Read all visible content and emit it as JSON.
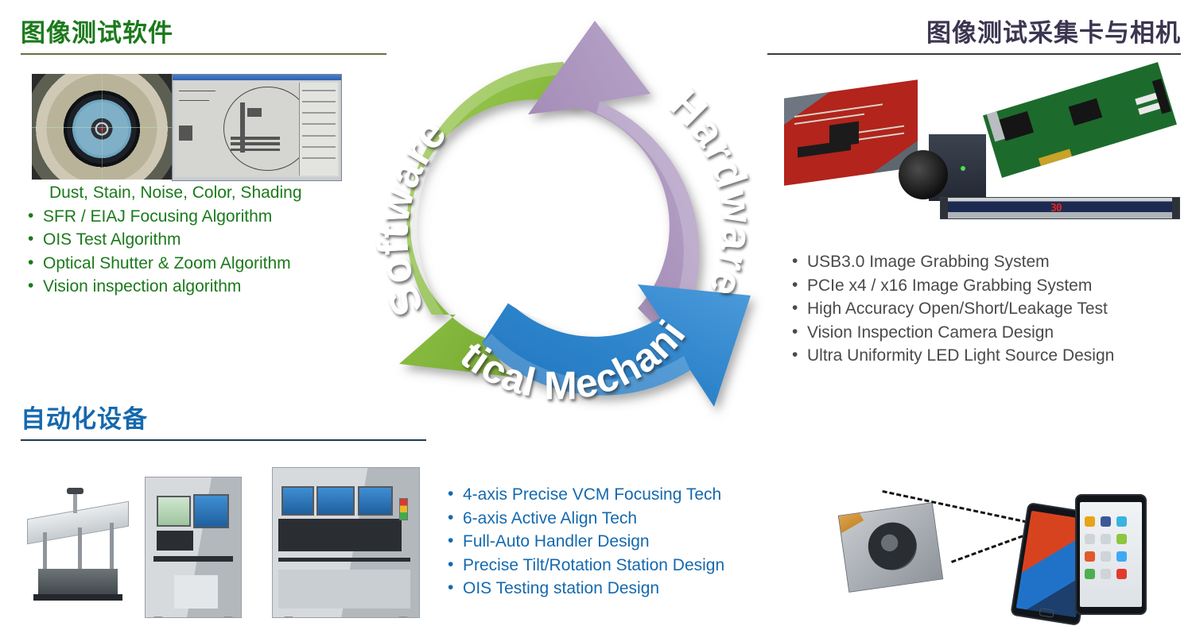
{
  "sections": {
    "software": {
      "title": "图像测试软件",
      "title_color": "#1b7a1b",
      "rule_color": "#6b6b3f",
      "bullets": [
        "Dust, Stain, Noise, Color, Shading",
        "SFR / EIAJ Focusing Algorithm",
        "OIS Test Algorithm",
        "Optical Shutter & Zoom Algorithm",
        "Vision inspection algorithm"
      ]
    },
    "hardware": {
      "title": "图像测试采集卡与相机",
      "title_color": "#3c3550",
      "rule_color": "#3a3a3a",
      "bullets": [
        "USB3.0 Image Grabbing System",
        "PCIe x4 / x16 Image Grabbing System",
        "High Accuracy Open/Short/Leakage Test",
        "Vision Inspection Camera Design",
        "Ultra Uniformity LED Light Source Design"
      ]
    },
    "automation": {
      "title": "自动化设备",
      "title_color": "#1569ae",
      "rule_color": "#1f3a53",
      "bullets": [
        "4-axis Precise VCM Focusing Tech",
        "6-axis Active Align Tech",
        "Full-Auto Handler Design",
        "Precise Tilt/Rotation Station Design",
        "OIS Testing station Design"
      ]
    }
  },
  "cycle": {
    "segments": [
      {
        "label": "Software",
        "color": "#84b73c",
        "color_dark": "#5d8a24"
      },
      {
        "label": "Hardware",
        "color": "#a892bb",
        "color_dark": "#7e6a92"
      },
      {
        "label": "Optical Mechanism",
        "color": "#2e84cb",
        "color_dark": "#1c5f9c"
      }
    ]
  },
  "led_bar": {
    "display_value": "30"
  },
  "images": {
    "software_lens": "microscope-lens-photo",
    "software_chart": "test-chart-software-window",
    "hw_test_board": "red-test-board-photo",
    "hw_camera": "industrial-camera-photo",
    "hw_pcie_card": "pcie-grabber-card-photo",
    "hw_led_bar": "led-light-source-bar-photo",
    "auto_machine_1": "conveyor-test-station-photo",
    "auto_machine_2": "handler-cabinet-machine-photo",
    "auto_machine_3": "large-handler-machine-photo",
    "camera_module": "camera-module-photo",
    "phone_1": "smartphone-photo-1",
    "phone_2": "smartphone-photo-2"
  }
}
